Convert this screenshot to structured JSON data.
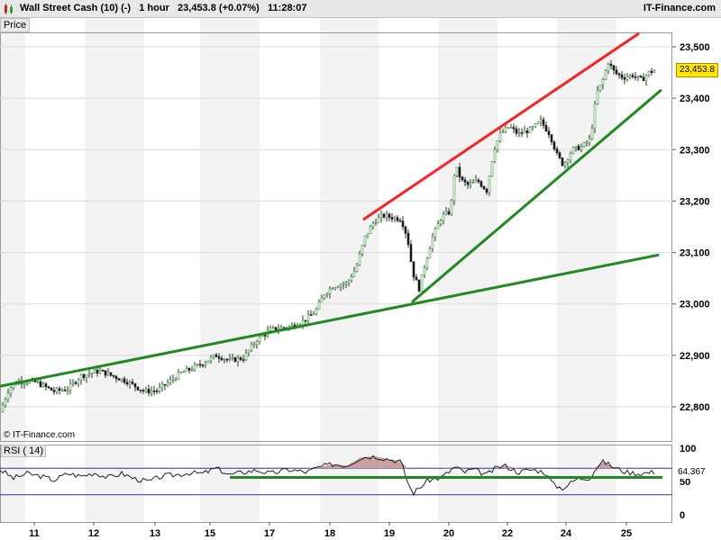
{
  "header": {
    "instrument": "Wall Street Cash (10) (-)",
    "timeframe": "1 hour",
    "price": "23,453.8 (+0.07%)",
    "time": "11:28:07",
    "brand": "IT-Finance.com"
  },
  "price_panel_label": "Price",
  "copyright": "© IT-Finance.com",
  "rsi_panel_label": "RSI ( 14)",
  "colors": {
    "bullish_candle": "#3a9a3a",
    "bearish_candle": "#222222",
    "resistance_line": "#ff2020",
    "support_line": "#1f8a1f",
    "rsi_line": "#222222",
    "rsi_overbought_fill": "#c9a1a1",
    "rsi_bound_line": "#3333aa",
    "price_tag": "#ffe600"
  },
  "chart_data": [
    {
      "type": "candlestick",
      "title": "Wall Street Cash (10) (-)",
      "timeframe": "1 hour",
      "ylim": [
        22750,
        23560
      ],
      "yticks": [
        22800,
        22900,
        23000,
        23100,
        23200,
        23300,
        23400,
        23500
      ],
      "ytick_labels": [
        "22,800",
        "22,900",
        "23,000",
        "23,100",
        "23,200",
        "23,300",
        "23,400",
        "23,500"
      ],
      "last_price_label": "23,453.8",
      "x_tick_labels": [
        "11",
        "12",
        "13",
        "15",
        "17",
        "18",
        "19",
        "20",
        "22",
        "24",
        "25"
      ],
      "close_path": [
        [
          0,
          22790
        ],
        [
          10,
          22835
        ],
        [
          20,
          22850
        ],
        [
          40,
          22848
        ],
        [
          60,
          22830
        ],
        [
          75,
          22835
        ],
        [
          90,
          22860
        ],
        [
          110,
          22870
        ],
        [
          140,
          22850
        ],
        [
          160,
          22830
        ],
        [
          175,
          22832
        ],
        [
          200,
          22865
        ],
        [
          220,
          22880
        ],
        [
          240,
          22900
        ],
        [
          255,
          22890
        ],
        [
          270,
          22895
        ],
        [
          285,
          22930
        ],
        [
          300,
          22950
        ],
        [
          320,
          22955
        ],
        [
          335,
          22965
        ],
        [
          350,
          22985
        ],
        [
          360,
          23020
        ],
        [
          370,
          23035
        ],
        [
          385,
          23040
        ],
        [
          395,
          23070
        ],
        [
          405,
          23130
        ],
        [
          415,
          23160
        ],
        [
          425,
          23172
        ],
        [
          435,
          23168
        ],
        [
          445,
          23165
        ],
        [
          452,
          23130
        ],
        [
          458,
          23060
        ],
        [
          465,
          23030
        ],
        [
          472,
          23080
        ],
        [
          480,
          23130
        ],
        [
          490,
          23170
        ],
        [
          500,
          23180
        ],
        [
          505,
          23270
        ],
        [
          512,
          23240
        ],
        [
          520,
          23230
        ],
        [
          530,
          23240
        ],
        [
          540,
          23220
        ],
        [
          548,
          23300
        ],
        [
          555,
          23330
        ],
        [
          565,
          23345
        ],
        [
          575,
          23330
        ],
        [
          590,
          23340
        ],
        [
          600,
          23355
        ],
        [
          610,
          23330
        ],
        [
          618,
          23290
        ],
        [
          625,
          23270
        ],
        [
          635,
          23300
        ],
        [
          645,
          23305
        ],
        [
          655,
          23320
        ],
        [
          662,
          23410
        ],
        [
          668,
          23430
        ],
        [
          675,
          23470
        ],
        [
          682,
          23450
        ],
        [
          692,
          23440
        ],
        [
          702,
          23445
        ],
        [
          712,
          23435
        ],
        [
          720,
          23450
        ],
        [
          726,
          23454
        ]
      ],
      "trend_lines": [
        {
          "name": "resistance",
          "color": "red",
          "from": [
            404,
            23165
          ],
          "to": [
            708,
            23525
          ]
        },
        {
          "name": "support-steep",
          "color": "green",
          "from": [
            458,
            23005
          ],
          "to": [
            733,
            23415
          ]
        },
        {
          "name": "support-long",
          "color": "green",
          "from": [
            0,
            22840
          ],
          "to": [
            730,
            23095
          ]
        }
      ]
    },
    {
      "type": "line",
      "title": "RSI ( 14)",
      "ylim": [
        0,
        100
      ],
      "yticks": [
        0,
        50,
        100
      ],
      "ytick_labels": [
        "0",
        "50",
        "100"
      ],
      "overbought": 70,
      "oversold": 30,
      "last_value_label": "64.367",
      "values_by_x": [
        [
          0,
          68
        ],
        [
          15,
          55
        ],
        [
          30,
          62
        ],
        [
          45,
          58
        ],
        [
          60,
          52
        ],
        [
          75,
          62
        ],
        [
          90,
          58
        ],
        [
          105,
          63
        ],
        [
          120,
          56
        ],
        [
          135,
          62
        ],
        [
          150,
          54
        ],
        [
          165,
          50
        ],
        [
          180,
          58
        ],
        [
          195,
          60
        ],
        [
          210,
          63
        ],
        [
          225,
          62
        ],
        [
          240,
          70
        ],
        [
          255,
          60
        ],
        [
          270,
          64
        ],
        [
          285,
          67
        ],
        [
          300,
          62
        ],
        [
          320,
          68
        ],
        [
          340,
          64
        ],
        [
          355,
          72
        ],
        [
          370,
          76
        ],
        [
          385,
          74
        ],
        [
          400,
          86
        ],
        [
          415,
          88
        ],
        [
          430,
          84
        ],
        [
          445,
          80
        ],
        [
          452,
          50
        ],
        [
          458,
          32
        ],
        [
          465,
          40
        ],
        [
          475,
          52
        ],
        [
          490,
          56
        ],
        [
          505,
          72
        ],
        [
          515,
          64
        ],
        [
          525,
          68
        ],
        [
          540,
          60
        ],
        [
          550,
          70
        ],
        [
          560,
          74
        ],
        [
          575,
          64
        ],
        [
          590,
          68
        ],
        [
          605,
          64
        ],
        [
          615,
          44
        ],
        [
          625,
          40
        ],
        [
          640,
          54
        ],
        [
          655,
          56
        ],
        [
          662,
          72
        ],
        [
          670,
          80
        ],
        [
          680,
          72
        ],
        [
          695,
          64
        ],
        [
          710,
          62
        ],
        [
          726,
          64
        ]
      ],
      "trend_lines": [
        {
          "name": "rsi-support",
          "color": "green",
          "from": [
            255,
            56
          ],
          "to": [
            735,
            56
          ]
        }
      ]
    }
  ]
}
